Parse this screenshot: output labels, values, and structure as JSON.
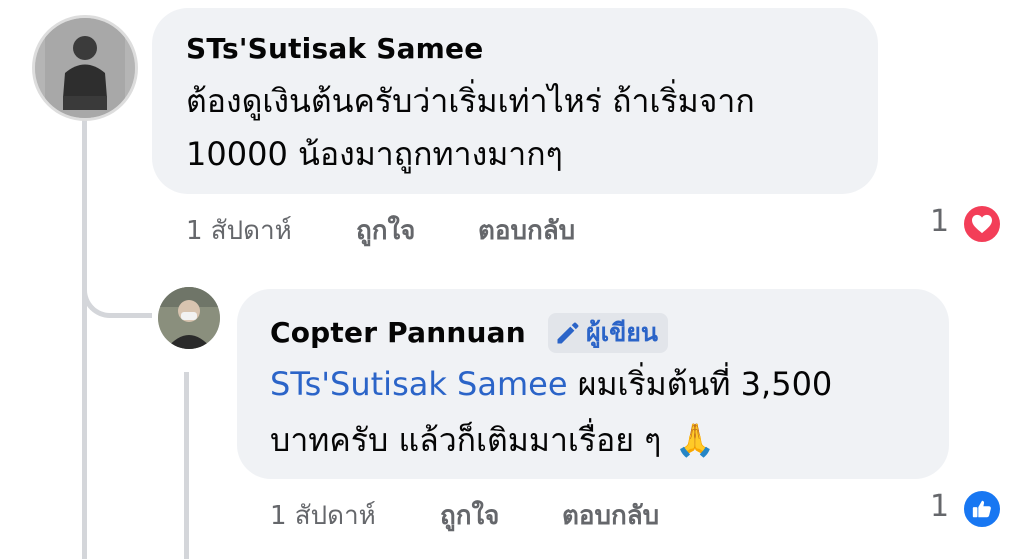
{
  "comment1": {
    "author": "STs'Sutisak Samee",
    "text_line1": "ต้องดูเงินต้นครับว่าเริ่มเท่าไหร่ ถ้าเริ่มจาก",
    "text_line2": "10000 น้องมาถูกทางมากๆ",
    "time": "1 สัปดาห์",
    "like_label": "ถูกใจ",
    "reply_label": "ตอบกลับ",
    "reaction_count": "1",
    "reaction_icon": "heart-icon",
    "reaction_color": "#f33e58"
  },
  "reply1": {
    "author": "Copter Pannuan",
    "author_badge": "ผู้เขียน",
    "mention": "STs'Sutisak Samee",
    "text_line1": " ผมเริ่มต้นที่ 3,500",
    "text_line2": "บาทครับ แล้วก็เติมมาเรื่อย ๆ",
    "emoji": "🙏",
    "time": "1 สัปดาห์",
    "like_label": "ถูกใจ",
    "reply_label": "ตอบกลับ",
    "reaction_count": "1",
    "reaction_icon": "thumbs-up-icon",
    "reaction_color": "#1877f2"
  }
}
